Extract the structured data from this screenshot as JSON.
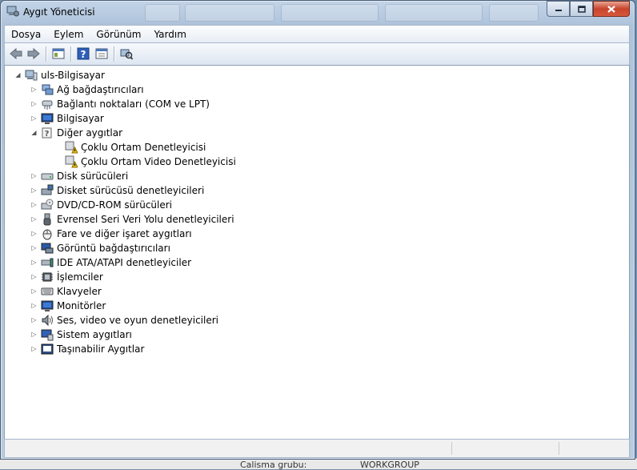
{
  "window": {
    "title": "Aygıt Yöneticisi"
  },
  "menu": [
    "Dosya",
    "Eylem",
    "Görünüm",
    "Yardım"
  ],
  "toolbar": [
    {
      "name": "back-button",
      "icon": "arrow-left-icon"
    },
    {
      "name": "forward-button",
      "icon": "arrow-right-icon"
    },
    {
      "name": "show-hide-console-tree-button",
      "icon": "console-tree-icon"
    },
    {
      "name": "help-button",
      "icon": "help-icon"
    },
    {
      "name": "properties-button",
      "icon": "properties-icon"
    },
    {
      "name": "scan-hardware-button",
      "icon": "scan-hardware-icon"
    }
  ],
  "tree": {
    "root": {
      "label": "uls-Bilgisayar",
      "icon": "computer-icon",
      "expanded": true
    },
    "categories": [
      {
        "label": "Ağ bağdaştırıcıları",
        "icon": "network-adapter-icon",
        "expanded": false
      },
      {
        "label": "Bağlantı noktaları (COM ve LPT)",
        "icon": "port-icon",
        "expanded": false
      },
      {
        "label": "Bilgisayar",
        "icon": "monitor-icon",
        "expanded": false
      },
      {
        "label": "Diğer aygıtlar",
        "icon": "unknown-device-icon",
        "expanded": true,
        "children": [
          {
            "label": "Çoklu Ortam Denetleyicisi",
            "icon": "warning-device-icon"
          },
          {
            "label": "Çoklu Ortam Video Denetleyicisi",
            "icon": "warning-device-icon"
          }
        ]
      },
      {
        "label": "Disk sürücüleri",
        "icon": "disk-drive-icon",
        "expanded": false
      },
      {
        "label": "Disket sürücüsü denetleyicileri",
        "icon": "floppy-controller-icon",
        "expanded": false
      },
      {
        "label": "DVD/CD-ROM sürücüleri",
        "icon": "dvd-drive-icon",
        "expanded": false
      },
      {
        "label": "Evrensel Seri Veri Yolu denetleyicileri",
        "icon": "usb-icon",
        "expanded": false
      },
      {
        "label": "Fare ve diğer işaret aygıtları",
        "icon": "mouse-icon",
        "expanded": false
      },
      {
        "label": "Görüntü bağdaştırıcıları",
        "icon": "display-adapter-icon",
        "expanded": false
      },
      {
        "label": "IDE ATA/ATAPI denetleyiciler",
        "icon": "ide-controller-icon",
        "expanded": false
      },
      {
        "label": "İşlemciler",
        "icon": "processor-icon",
        "expanded": false
      },
      {
        "label": "Klavyeler",
        "icon": "keyboard-icon",
        "expanded": false
      },
      {
        "label": "Monitörler",
        "icon": "monitor-icon",
        "expanded": false
      },
      {
        "label": "Ses, video ve oyun denetleyicileri",
        "icon": "speaker-icon",
        "expanded": false
      },
      {
        "label": "Sistem aygıtları",
        "icon": "system-device-icon",
        "expanded": false
      },
      {
        "label": "Taşınabilir Aygıtlar",
        "icon": "portable-device-icon",
        "expanded": false
      }
    ]
  },
  "background_text": {
    "left": "Calisma grubu:",
    "right": "WORKGROUP"
  },
  "colors": {
    "title_bg": "#b8cbe0",
    "close": "#c8442c",
    "warning": "#f2c200"
  }
}
